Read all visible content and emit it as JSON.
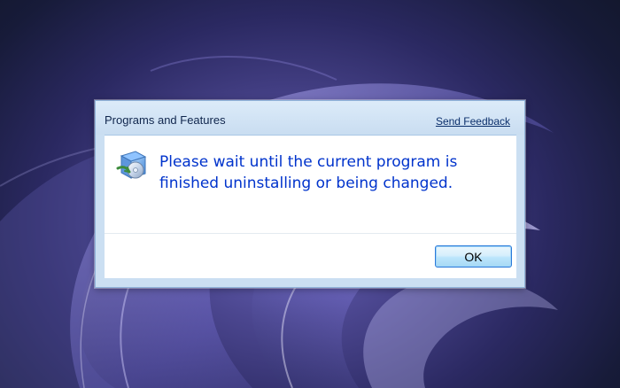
{
  "dialog": {
    "title": "Programs and Features",
    "feedback_link": "Send Feedback",
    "icon": "programs-and-features-icon",
    "message": "Please wait until the current program is finished uninstalling or being changed.",
    "ok_label": "OK"
  },
  "colors": {
    "message_text": "#0033cc",
    "title_bar": "#cbdff2",
    "wallpaper_glow": "#6f6ac2"
  }
}
